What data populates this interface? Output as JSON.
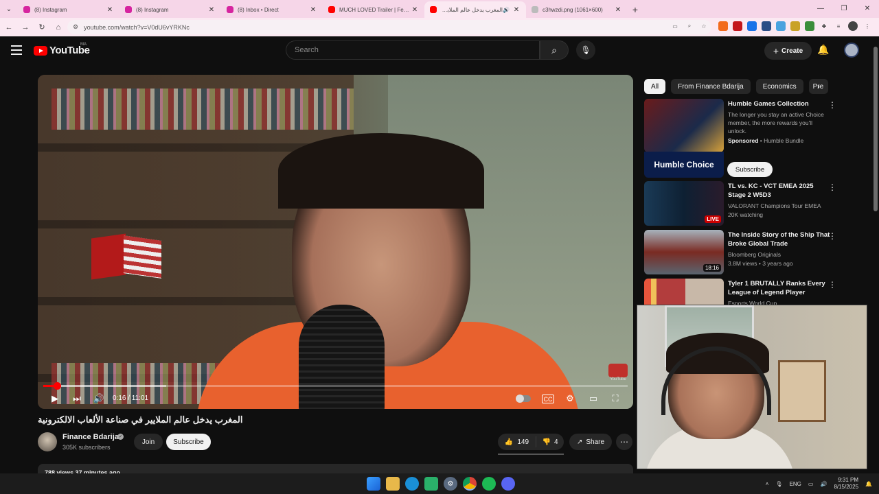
{
  "browser": {
    "tabs": [
      {
        "title": "(8) Instagram",
        "color": "#d6249f"
      },
      {
        "title": "(8) Instagram",
        "color": "#d6249f"
      },
      {
        "title": "(8) Inbox • Direct",
        "color": "#d6249f"
      },
      {
        "title": "MUCH LOVED Trailer | Festival",
        "color": "#ff0000"
      },
      {
        "title": "المغرب يدخل عالم الملايين في",
        "color": "#ff0000",
        "active": true
      },
      {
        "title": "c3hwzdi.png (1061×600)",
        "color": "#999999"
      }
    ],
    "url": "youtube.com/watch?v=V0dU6vYRKNc"
  },
  "header": {
    "logo_text": "YouTube",
    "country": "MA",
    "search_placeholder": "Search",
    "create_label": "Create"
  },
  "player": {
    "time": "0:16 / 11:01",
    "progress_fraction": 0.024,
    "buffer_fraction": 0.21,
    "watermark": "YouTube"
  },
  "video": {
    "title": "المغرب يدخل عالم الملايير في صناعة الألعاب الالكترونية",
    "channel": "Finance Bdarija",
    "subscribers": "305K subscribers",
    "join_label": "Join",
    "subscribe_label": "Subscribe",
    "likes": "149",
    "dislikes": "4",
    "share_label": "Share",
    "views_line": "788 views  37 minutes ago"
  },
  "chips": [
    "All",
    "From Finance Bdarija",
    "Economics",
    "Pre"
  ],
  "recommendations": [
    {
      "title": "Humble Games Collection",
      "desc": "The longer you stay an active Choice member, the more rewards you'll unlock.",
      "sponsored": "Sponsored",
      "advertiser": "Humble Bundle",
      "banner": "Humble Choice",
      "cta": "Subscribe"
    },
    {
      "title": "TL vs. KC - VCT EMEA 2025 Stage 2 W5D3",
      "channel": "VALORANT Champions Tour EMEA",
      "stats": "20K watching",
      "badge": "LIVE"
    },
    {
      "title": "The Inside Story of the Ship That Broke Global Trade",
      "channel": "Bloomberg Originals",
      "stats": "3.8M views • 3 years ago",
      "duration": "18:16"
    },
    {
      "title": "Tyler 1 BRUTALLY Ranks Every League of Legend Player",
      "channel": "Esports World Cup"
    }
  ],
  "taskbar": {
    "lang": "ENG",
    "time": "9:31 PM",
    "date": "8/15/2025"
  }
}
